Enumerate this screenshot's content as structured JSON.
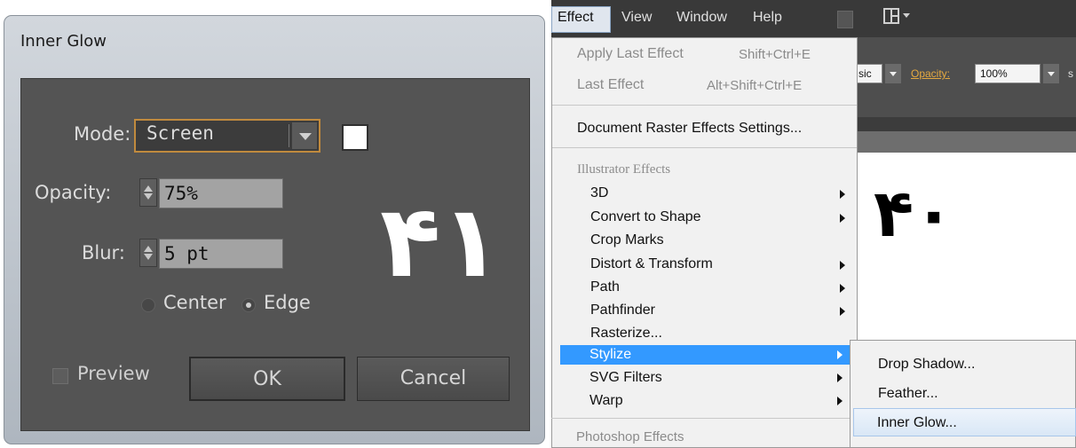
{
  "dialog": {
    "title": "Inner Glow",
    "mode_label": "Mode:",
    "mode_value": "Screen",
    "opacity_label": "Opacity:",
    "opacity_value": "75%",
    "blur_label": "Blur:",
    "blur_value": "5 pt",
    "center_label": "Center",
    "edge_label": "Edge",
    "selected_radio": "Edge",
    "preview_label": "Preview",
    "ok_label": "OK",
    "cancel_label": "Cancel",
    "glow_color": "#ffffff",
    "annotation_number": "۴۱"
  },
  "menubar": {
    "items": [
      "Effect",
      "View",
      "Window",
      "Help"
    ],
    "active": "Effect"
  },
  "control_bar": {
    "style_fragment": "sic",
    "opacity_label": "Opacity:",
    "opacity_value": "100%",
    "trailing_fragment": "s"
  },
  "effect_menu": {
    "apply_last": {
      "label": "Apply Last Effect",
      "shortcut": "Shift+Ctrl+E"
    },
    "last": {
      "label": "Last Effect",
      "shortcut": "Alt+Shift+Ctrl+E"
    },
    "doc_raster": "Document Raster Effects Settings...",
    "illustrator_header": "Illustrator Effects",
    "items": [
      "3D",
      "Convert to Shape",
      "Crop Marks",
      "Distort & Transform",
      "Path",
      "Pathfinder",
      "Rasterize...",
      "Stylize",
      "SVG Filters",
      "Warp"
    ],
    "highlighted": "Stylize",
    "photoshop_header": "Photoshop Effects"
  },
  "stylize_submenu": {
    "items": [
      "Drop Shadow...",
      "Feather...",
      "Inner Glow..."
    ],
    "hovered": "Inner Glow..."
  },
  "canvas": {
    "annotation_number": "۴۰"
  },
  "colors": {
    "dialog_panel": "#545454",
    "menu_highlight": "#3399ff",
    "menubar": "#393939"
  }
}
